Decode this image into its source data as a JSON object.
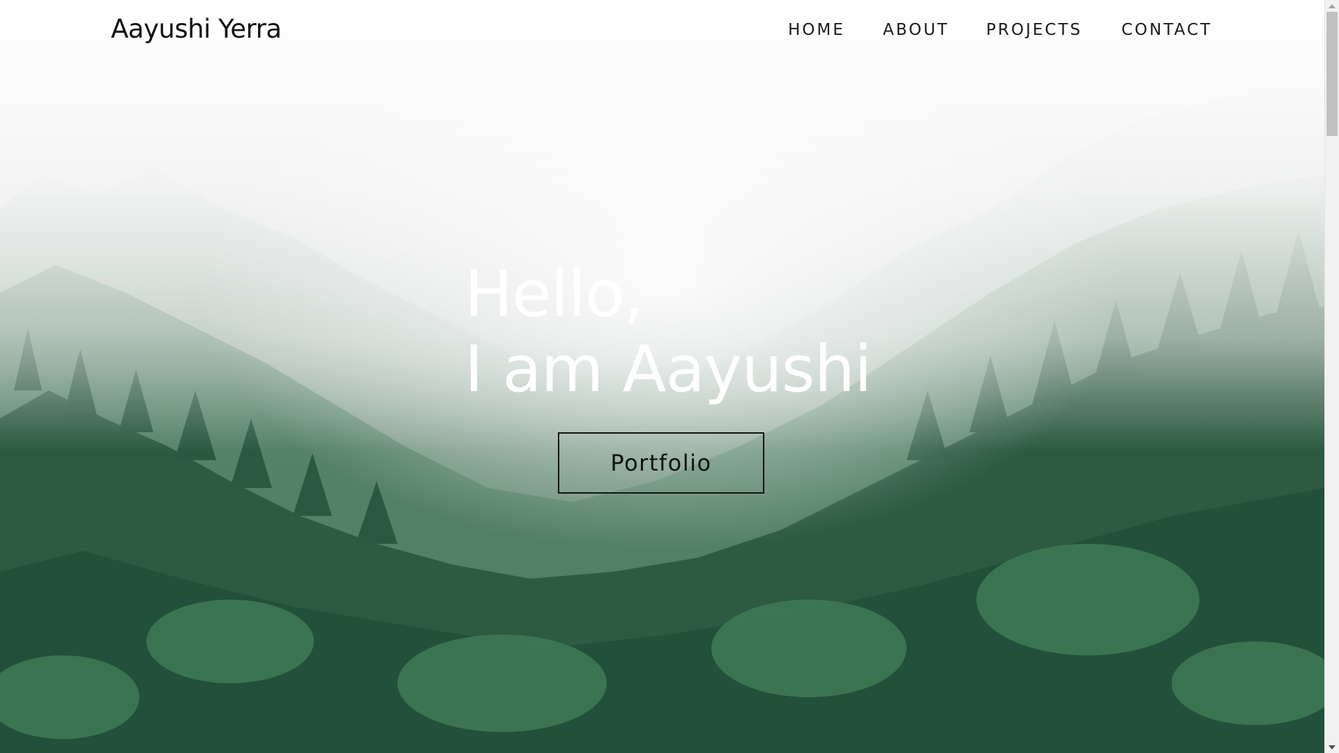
{
  "header": {
    "brand": "Aayushi Yerra"
  },
  "nav": {
    "items": [
      {
        "label": "HOME"
      },
      {
        "label": "ABOUT"
      },
      {
        "label": "PROJECTS"
      },
      {
        "label": "CONTACT"
      }
    ]
  },
  "hero": {
    "line1": "Hello,",
    "line2": "I am Aayushi",
    "button_label": "Portfolio",
    "background": "misty-pine-forest"
  },
  "colors": {
    "heading": "#ffffff",
    "text_dark": "#111111",
    "forest_dark": "#234a34",
    "forest_mid": "#2f5e43",
    "mist": "#eef0ef"
  },
  "icons": {
    "scroll_up": "chevron-up-icon",
    "scroll_down": "chevron-down-icon"
  }
}
